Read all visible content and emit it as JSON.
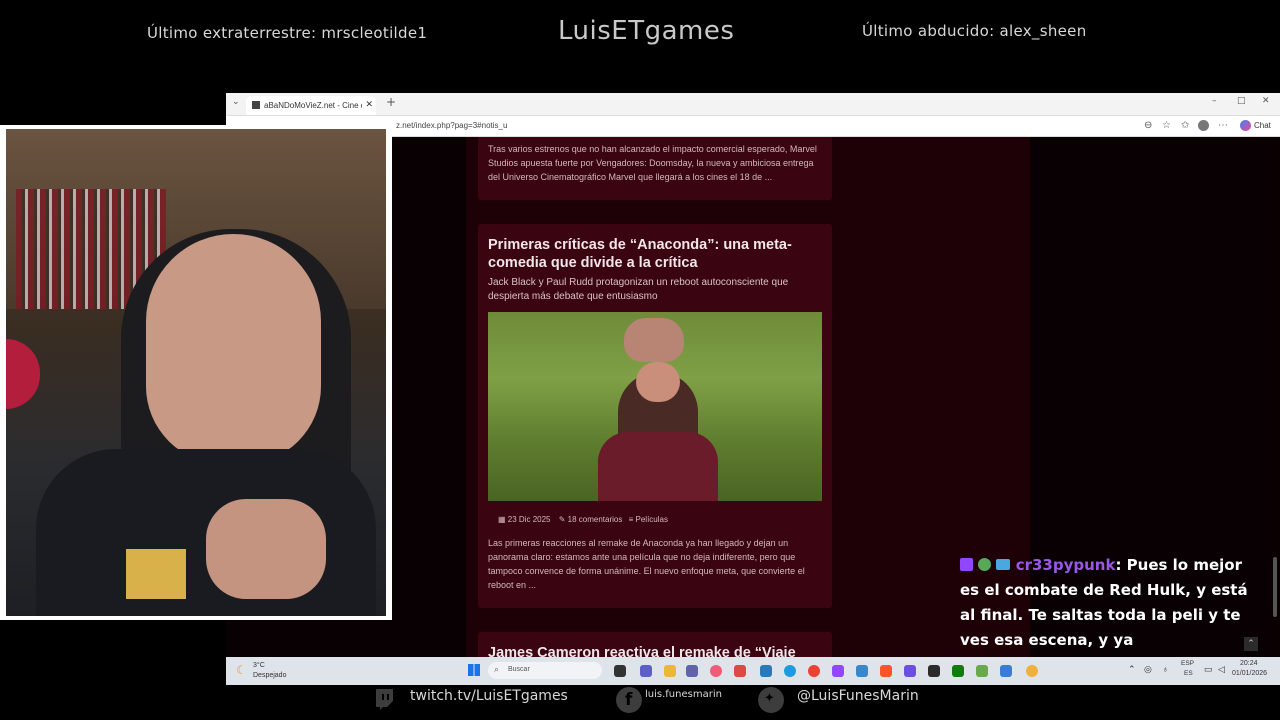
{
  "overlay": {
    "last_alien_label": "Último extraterrestre: mrscleotilde1",
    "channel_title": "LuisETgames",
    "last_abducted_label": "Último abducido: alex_sheen"
  },
  "browser": {
    "tab_title": "aBaNDoMoVieZ.net - Cine de terror",
    "url": "z.net/index.php?pag=3#notis_u",
    "chat_button": "Chat",
    "close_tab_glyph": "✕",
    "new_tab_glyph": "+",
    "win_minimize": "–",
    "win_maximize": "□",
    "win_close": "✕"
  },
  "articles": [
    {
      "excerpt": "Tras varios estrenos que no han alcanzado el impacto comercial esperado, Marvel Studios apuesta fuerte por Vengadores: Doomsday, la nueva y ambiciosa entrega del Universo Cinematográfico Marvel que llegará a los cines el 18 de ..."
    },
    {
      "title": "Primeras críticas de “Anaconda”: una meta-comedia que divide a la crítica",
      "subtitle": "Jack Black y Paul Rudd protagonizan un reboot autoconsciente que despierta más debate que entusiasmo",
      "date": "23 Dic 2025",
      "comments": "18 comentarios",
      "category": "Películas",
      "excerpt": "Las primeras reacciones al remake de Anaconda ya han llegado y dejan un panorama claro: estamos ante una película que no deja indiferente, pero que tampoco convence de forma unánime. El nuevo enfoque meta, que convierte el reboot en ..."
    },
    {
      "title": "James Cameron reactiva el remake de “Viaje"
    }
  ],
  "taskbar": {
    "weather_temp": "3°C",
    "weather_desc": "Despejado",
    "search_placeholder": "Buscar",
    "lang_top": "ESP",
    "lang_bottom": "ES",
    "time": "20:24",
    "date": "01/01/2026"
  },
  "chat": {
    "username": "cr33pypunk",
    "message": ": Pues lo mejor es el combate de Red Hulk, y está al final. Te saltas toda la peli y te ves esa escena, y ya"
  },
  "footer": {
    "twitch": "twitch.tv/LuisETgames",
    "facebook": "luis.funesmarin",
    "twitter": "@LuisFunesMarin"
  },
  "colors": {
    "site_background": "#1e0107",
    "card_background": "#3a0510",
    "chat_username": "#9b57e6"
  }
}
